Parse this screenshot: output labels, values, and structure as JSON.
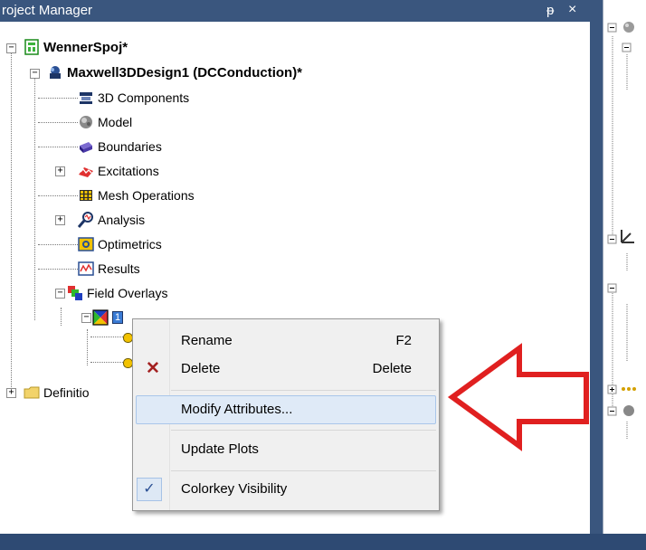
{
  "panel": {
    "title": "roject Manager",
    "pin_glyph": "ᵽ",
    "close_glyph": "×"
  },
  "tree": {
    "root": {
      "label": "WennerSpoj*",
      "icon": "project-icon",
      "expanded": true
    },
    "design": {
      "label": "Maxwell3DDesign1 (DCConduction)*",
      "icon": "maxwell-design-icon",
      "expanded": true
    },
    "children": [
      {
        "label": "3D Components",
        "icon": "components-icon"
      },
      {
        "label": "Model",
        "icon": "model-icon"
      },
      {
        "label": "Boundaries",
        "icon": "boundaries-icon"
      },
      {
        "label": "Excitations",
        "icon": "excitations-icon",
        "expandable": true
      },
      {
        "label": "Mesh Operations",
        "icon": "mesh-icon"
      },
      {
        "label": "Analysis",
        "icon": "analysis-icon",
        "expandable": true
      },
      {
        "label": "Optimetrics",
        "icon": "optimetrics-icon"
      },
      {
        "label": "Results",
        "icon": "results-icon"
      },
      {
        "label": "Field Overlays",
        "icon": "field-overlays-icon",
        "expanded": true
      }
    ],
    "overlay_item_label": "1",
    "definitions_label": "Definitio"
  },
  "context_menu": {
    "items": [
      {
        "label": "Rename",
        "shortcut": "F2"
      },
      {
        "label": "Delete",
        "shortcut": "Delete",
        "icon": "delete-x-icon"
      },
      {
        "label": "Modify Attributes...",
        "highlighted": true
      },
      {
        "label": "Update Plots"
      },
      {
        "label": "Colorkey Visibility",
        "checked": true
      }
    ]
  },
  "annotation": {
    "shape": "red-arrow-outline",
    "color": "#e02020"
  },
  "colors": {
    "title_bar": "#3a567e",
    "highlight": "#dfeaf7",
    "arrow": "#e02020"
  }
}
